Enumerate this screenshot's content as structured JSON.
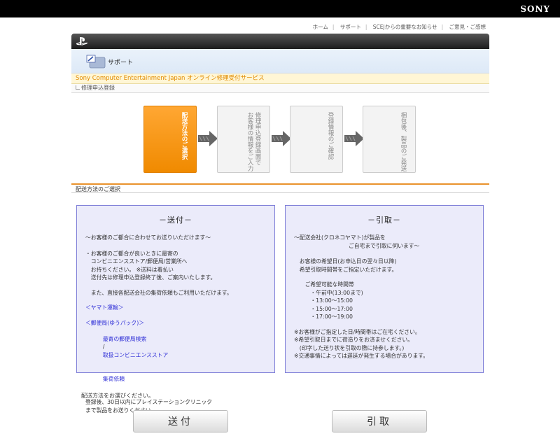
{
  "brand": "SONY",
  "top_links": [
    "ホーム",
    "サポート",
    "SCEJからの重要なお知らせ",
    "ご意見・ご感想"
  ],
  "support_title": "サポート",
  "service_name": "Sony Computer Entertainment Japan オンライン修理受付サービス",
  "breadcrumb": "修理申込登録",
  "steps": [
    {
      "label": "配送方法のご選択",
      "active": true
    },
    {
      "label": "修理申込登録画面で\nお客様の情報をご入力",
      "active": false
    },
    {
      "label": "登録情報のご確認",
      "active": false
    },
    {
      "label": "梱包後、製品のご発送",
      "active": false
    }
  ],
  "section_title": "配送方法のご選択",
  "send_box": {
    "heading": "－送付－",
    "intro": "～お客様のご都合に合わせてお送りいただけます～",
    "para1": "・お客様のご都合が良いときに最寄の\n　コンビニエンスストア/郵便局/営業所へ\n　お持ちください。 ※送料は着払い\n　送付先は修理申込登録終了後、ご案内いたします。",
    "para2": "　また、直接各配送会社の集荷依頼もご利用いただけます。",
    "yamato": "＜ヤマト運輸＞",
    "yubin": "＜郵便局(ゆうパック)＞",
    "link1": "最寄の郵便局検索",
    "link_sep": "/",
    "link2": "取扱コンビニエンスストア",
    "link3": "集荷依頼",
    "footer": "登録後、30日以内にプレイステーションクリニック\nまで製品をお送りください。"
  },
  "pickup_box": {
    "heading": "－引取－",
    "intro": "～配送会社(クロネコヤマト)が製品を\n　　　　　　　　　　ご自宅まで引取に伺います～",
    "para1": "　お客様の希望日(お申込日の翌々日以降)\n　希望引取時間帯をご指定いただけます。",
    "slots_title": "　　ご希望可能な時間帯",
    "slots": [
      "　　　・午前中(13:00まで)",
      "　　　・13:00～15:00",
      "　　　・15:00～17:00",
      "　　　・17:00～19:00"
    ],
    "notes": "※お客様がご指定した日/時間帯はご在宅ください。\n※希望引取日までに荷造りをお済ませください。\n　(印字した送り状を引取の際に持参します。)\n※交通事情によっては遅延が発生する場合があります。"
  },
  "select_note": "配送方法をお選びください。",
  "buttons": {
    "send": "送付",
    "pickup": "引取"
  }
}
